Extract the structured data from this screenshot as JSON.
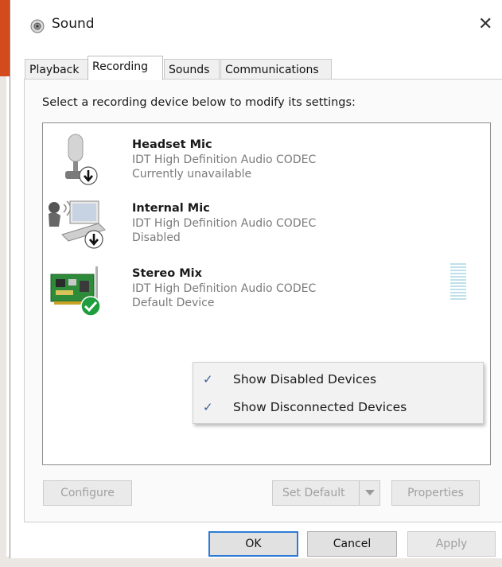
{
  "window": {
    "title": "Sound",
    "close_glyph": "✕"
  },
  "tabs": [
    {
      "label": "Playback",
      "active": false
    },
    {
      "label": "Recording",
      "active": true
    },
    {
      "label": "Sounds",
      "active": false
    },
    {
      "label": "Communications",
      "active": false
    }
  ],
  "recording": {
    "instruction": "Select a recording device below to modify its settings:",
    "devices": [
      {
        "name": "Headset Mic",
        "driver": "IDT High Definition Audio CODEC",
        "status": "Currently unavailable",
        "icon": "microphone-icon",
        "badge": "down-arrow-badge-icon"
      },
      {
        "name": "Internal Mic",
        "driver": "IDT High Definition Audio CODEC",
        "status": "Disabled",
        "icon": "laptop-mic-icon",
        "badge": "down-arrow-badge-icon"
      },
      {
        "name": "Stereo Mix",
        "driver": "IDT High Definition Audio CODEC",
        "status": "Default Device",
        "icon": "sound-card-icon",
        "badge": "green-check-badge-icon"
      }
    ],
    "level_meter_bars": 12
  },
  "context_menu": {
    "items": [
      {
        "label": "Show Disabled Devices",
        "checked": true
      },
      {
        "label": "Show Disconnected Devices",
        "checked": true
      }
    ]
  },
  "buttons": {
    "configure": "Configure",
    "set_default": "Set Default",
    "properties": "Properties",
    "ok": "OK",
    "cancel": "Cancel",
    "apply": "Apply"
  },
  "colors": {
    "accent": "#2e7bd6",
    "check_badge": "#1e9e3e",
    "menu_check": "#3f5a9c",
    "disabled_text": "#a0a0a0"
  }
}
